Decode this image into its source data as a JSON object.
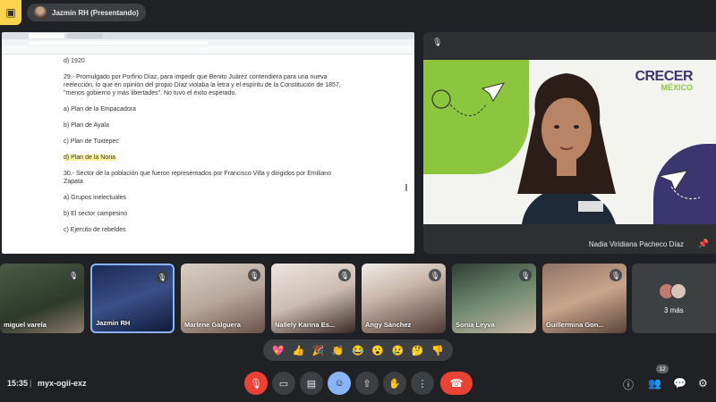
{
  "topbar": {
    "presenter_label": "Jazmin RH (Presentando)"
  },
  "document": {
    "lines": [
      {
        "text": "d) 1920",
        "highlight": false
      },
      {
        "text": "29.- Promulgado por Porfirio Díaz, para impedir que Benito Juárez contendiera para una nueva reelección, lo que en opinión del propio Díaz violaba la letra y el espíritu de la Constitución de 1857, \"menos gobierno y más libertades\". No tuvo el éxito esperado.",
        "highlight": false
      },
      {
        "text": "a)  Plan de la Empacadora",
        "highlight": false
      },
      {
        "text": "b) Plan de Ayala",
        "highlight": false
      },
      {
        "text": "c) Plan de Tuxtepec",
        "highlight": false
      },
      {
        "text": "d) Plan de la Noria",
        "highlight": true
      },
      {
        "text": "30.- Sector de la población que fueron representados por Francisco Villa y dirigidos por Emiliano Zapata",
        "highlight": false
      },
      {
        "text": "a) Grupos inelectuales",
        "highlight": false
      },
      {
        "text": "b) El sector campesino",
        "highlight": false
      },
      {
        "text": "c) Ejercito de rebeldes",
        "highlight": false
      }
    ]
  },
  "speaker": {
    "name": "Nadia Viridiana Pacheco Díaz",
    "logo_main": "CRECER",
    "logo_sub": "MÉXICO",
    "colors": {
      "green": "#8cc63f",
      "purple": "#3b3570"
    }
  },
  "participants": [
    {
      "name": "miguel varela",
      "active": false
    },
    {
      "name": "Jazmin RH",
      "active": true
    },
    {
      "name": "Marlene Galguera",
      "active": false
    },
    {
      "name": "Nallely Karina Es...",
      "active": false
    },
    {
      "name": "Angy Sánchez",
      "active": false
    },
    {
      "name": "Sonia Leyva",
      "active": false
    },
    {
      "name": "Guillermina Gon...",
      "active": false
    }
  ],
  "more_participants": "3 más",
  "reactions": [
    "💖",
    "👍",
    "🎉",
    "👏",
    "😂",
    "😮",
    "😢",
    "🤔",
    "👎"
  ],
  "bottombar": {
    "time": "15:35",
    "separator": "|",
    "meeting_code": "myx-ogii-exz",
    "people_count": "12"
  }
}
